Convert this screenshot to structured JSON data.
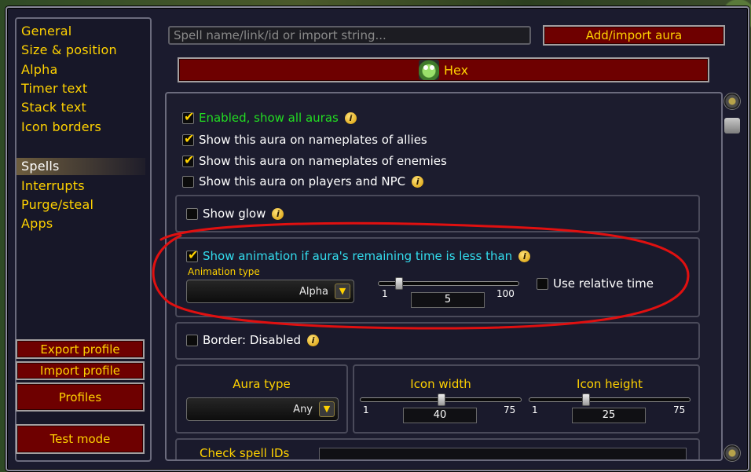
{
  "sidebar": {
    "items": [
      {
        "label": "General"
      },
      {
        "label": "Size & position"
      },
      {
        "label": "Alpha"
      },
      {
        "label": "Timer text"
      },
      {
        "label": "Stack text"
      },
      {
        "label": "Icon borders"
      },
      {
        "label": "Spells"
      },
      {
        "label": "Interrupts"
      },
      {
        "label": "Purge/steal"
      },
      {
        "label": "Apps"
      }
    ],
    "export_label": "Export profile",
    "import_label": "Import profile",
    "profiles_label": "Profiles",
    "test_mode_label": "Test mode"
  },
  "header": {
    "search_placeholder": "Spell name/link/id or import string...",
    "add_label": "Add/import aura",
    "selected_aura": "Hex"
  },
  "content": {
    "enabled_label": "Enabled, show all auras",
    "allies_label": "Show this aura on nameplates of allies",
    "enemies_label": "Show this aura on nameplates of enemies",
    "players_label": "Show this aura on players and NPC",
    "glow_label": "Show glow",
    "animation_label": "Show animation if aura's remaining time is less than",
    "animation_type_label": "Animation type",
    "animation_type_value": "Alpha",
    "animation_slider": {
      "min": "1",
      "max": "100",
      "value": "5"
    },
    "relative_time_label": "Use relative time",
    "border_label": "Border: Disabled",
    "aura_type_label": "Aura type",
    "aura_type_value": "Any",
    "icon_width": {
      "label": "Icon width",
      "min": "1",
      "max": "75",
      "value": "40"
    },
    "icon_height": {
      "label": "Icon height",
      "min": "1",
      "max": "75",
      "value": "25"
    },
    "check_spell_ids_label": "Check spell IDs"
  },
  "colors": {
    "gold": "#ffd200",
    "green": "#22dd22",
    "cyan": "#33ddee",
    "button_red": "#6e0000",
    "annotation_red": "#e01010"
  }
}
